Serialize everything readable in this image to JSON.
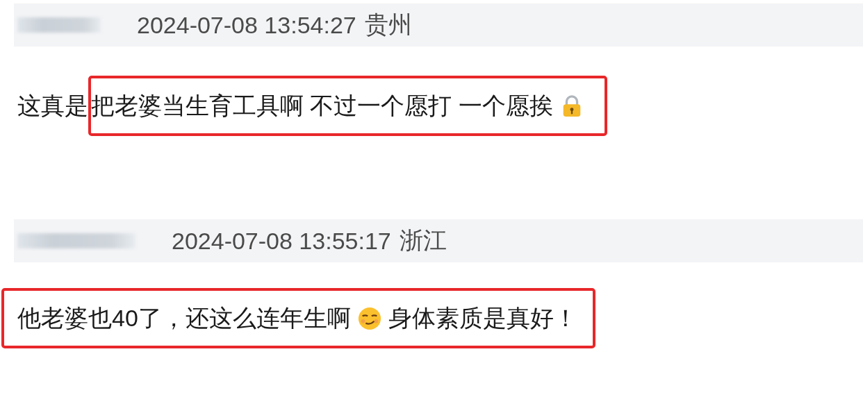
{
  "comments": [
    {
      "time": "2024-07-08 13:54:27",
      "location": "贵州",
      "segments": [
        {
          "highlighted": false,
          "items": [
            {
              "kind": "text",
              "text": "这真是"
            }
          ]
        },
        {
          "highlighted": true,
          "items": [
            {
              "kind": "text",
              "text": "把老婆当生育工具啊 不过一个愿打 一个愿挨"
            },
            {
              "kind": "lock"
            }
          ]
        }
      ]
    },
    {
      "time": "2024-07-08 13:55:17",
      "location": "浙江",
      "segments": [
        {
          "highlighted": true,
          "items": [
            {
              "kind": "text",
              "text": "他老婆也40了，还这么连年生啊"
            },
            {
              "kind": "smirk"
            },
            {
              "kind": "text",
              "text": "身体素质是真好！"
            }
          ]
        }
      ]
    }
  ]
}
